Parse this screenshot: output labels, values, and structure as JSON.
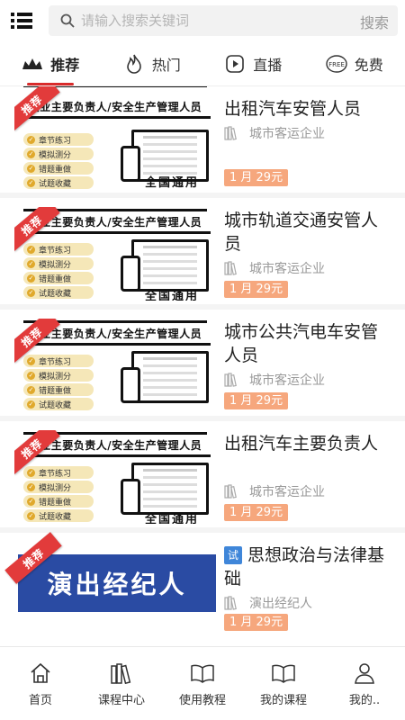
{
  "header": {
    "search_placeholder": "请输入搜索关键词",
    "search_button": "搜索",
    "icons": {
      "menu": "list-menu-icon",
      "search": "magnifier-icon"
    }
  },
  "tabs": [
    {
      "label": "推荐",
      "icon": "crown-icon",
      "active": true
    },
    {
      "label": "热门",
      "icon": "flame-icon",
      "active": false
    },
    {
      "label": "直播",
      "icon": "play-icon",
      "active": false
    },
    {
      "label": "免费",
      "icon": "free-icon",
      "active": false
    }
  ],
  "thumbnail": {
    "ribbon": "推荐",
    "heading": "企业主要负责人/安全生产管理人员",
    "features": [
      "章节练习",
      "模拟测分",
      "错题重做",
      "试题收藏"
    ],
    "footer": "全国通用"
  },
  "courses": [
    {
      "title": "出租汽车安管人员",
      "category": "城市客运企业",
      "price": "1 月 29元",
      "thumb": "generic"
    },
    {
      "title": "城市轨道交通安管人员",
      "category": "城市客运企业",
      "price": "1 月 29元",
      "thumb": "generic"
    },
    {
      "title": "城市公共汽电车安管人员",
      "category": "城市客运企业",
      "price": "1 月 29元",
      "thumb": "generic"
    },
    {
      "title": "出租汽车主要负责人",
      "category": "城市客运企业",
      "price": "1 月 29元",
      "thumb": "generic"
    },
    {
      "title": "思想政治与法律基础",
      "category": "演出经纪人",
      "price": "1 月 29元",
      "thumb": "perform",
      "badge": "试",
      "banner": "演出经纪人"
    }
  ],
  "bottom_nav": [
    {
      "label": "首页",
      "icon": "home-icon"
    },
    {
      "label": "课程中心",
      "icon": "books-icon"
    },
    {
      "label": "使用教程",
      "icon": "open-book-icon"
    },
    {
      "label": "我的课程",
      "icon": "open-book-icon"
    },
    {
      "label": "我的..",
      "icon": "user-icon"
    }
  ],
  "colors": {
    "accent": "#d92b2b",
    "price_bg": "#f6a77d",
    "ribbon": "#e23b3b",
    "try_badge": "#3f86d9",
    "banner_blue": "#2a4ba3"
  }
}
